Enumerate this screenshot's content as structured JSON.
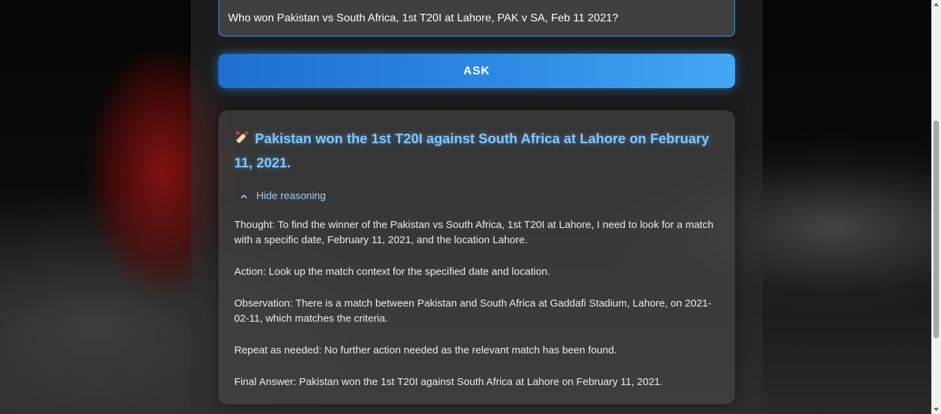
{
  "query": {
    "value": "Who won Pakistan vs South Africa, 1st T20I at Lahore, PAK v SA, Feb 11 2021?"
  },
  "ask_button": {
    "label": "ASK"
  },
  "answer": {
    "icon": "cricket-bat-icon",
    "title": "Pakistan won the 1st T20I against South Africa at Lahore on February 11, 2021.",
    "toggle_label": "Hide reasoning",
    "reasoning": [
      "Thought: To find the winner of the Pakistan vs South Africa, 1st T20I at Lahore, I need to look for a match with a specific date, February 11, 2021, and the location Lahore.",
      "Action: Look up the match context for the specified date and location.",
      "Observation: There is a match between Pakistan and South Africa at Gaddafi Stadium, Lahore, on 2021-02-11, which matches the criteria.",
      "Repeat as needed: No further action needed as the relevant match has been found.",
      "Final Answer: Pakistan won the 1st T20I against South Africa at Lahore on February 11, 2021."
    ]
  },
  "colors": {
    "accent": "#7fc8f8",
    "button_start": "#1e6fcf",
    "button_end": "#44a6f5",
    "input_border": "#4a90d9"
  }
}
